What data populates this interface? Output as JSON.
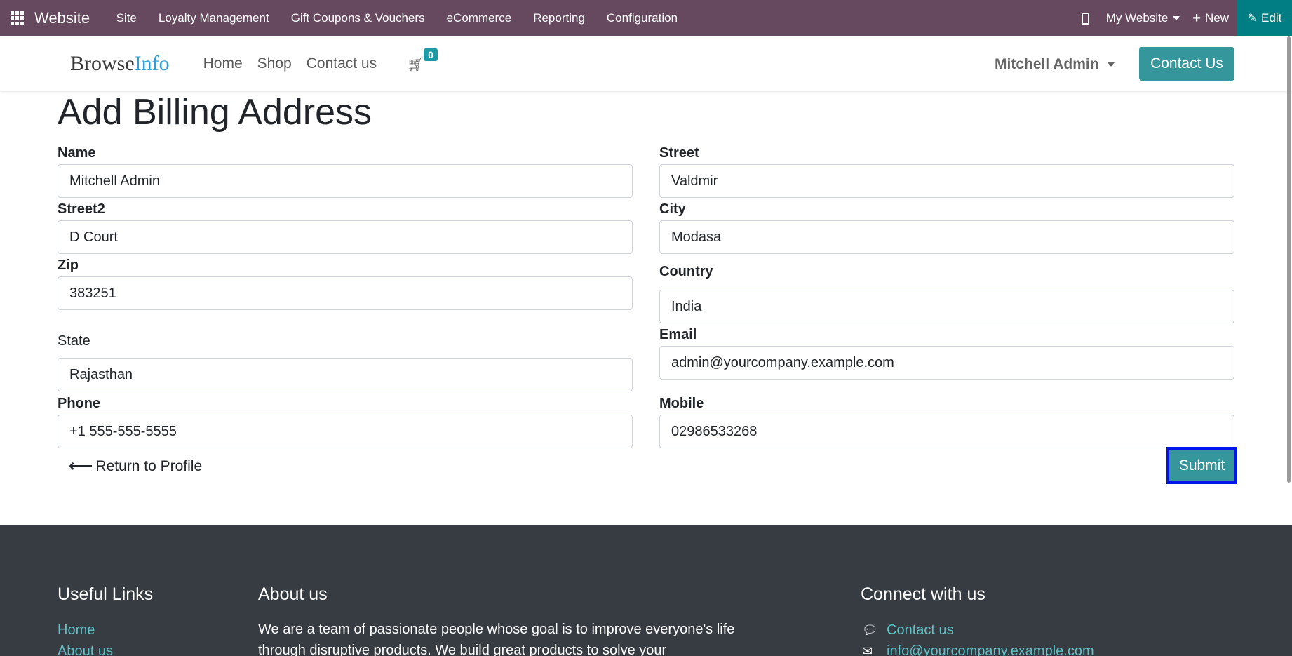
{
  "topbar": {
    "app_name": "Website",
    "menu": [
      "Site",
      "Loyalty Management",
      "Gift Coupons & Vouchers",
      "eCommerce",
      "Reporting",
      "Configuration"
    ],
    "website_selector": "My Website",
    "new_label": "New",
    "edit_label": "Edit",
    "bg_color": "#66495f",
    "edit_color": "#017e84"
  },
  "header": {
    "logo_part1": "Browse",
    "logo_part2": "Info",
    "nav": [
      "Home",
      "Shop",
      "Contact us"
    ],
    "cart_count": "0",
    "user": "Mitchell Admin",
    "cta": "Contact Us",
    "accent_color": "#35979c"
  },
  "form": {
    "title": "Add Billing Address",
    "fields": {
      "name": {
        "label": "Name",
        "value": "Mitchell Admin"
      },
      "street": {
        "label": "Street",
        "value": "Valdmir"
      },
      "street2": {
        "label": "Street2",
        "value": "D Court"
      },
      "city": {
        "label": "City",
        "value": "Modasa"
      },
      "zip": {
        "label": "Zip",
        "value": "383251"
      },
      "country": {
        "label": "Country",
        "value": "India"
      },
      "state": {
        "label": "State",
        "value": "Rajasthan"
      },
      "email": {
        "label": "Email",
        "value": "admin@yourcompany.example.com"
      },
      "phone": {
        "label": "Phone",
        "value": "+1 555-555-5555"
      },
      "mobile": {
        "label": "Mobile",
        "value": "02986533268"
      }
    },
    "return_label": "Return to Profile",
    "submit_label": "Submit"
  },
  "footer": {
    "useful_links_title": "Useful Links",
    "useful_links": [
      "Home",
      "About us"
    ],
    "about_title": "About us",
    "about_text": "We are a team of passionate people whose goal is to improve everyone's life through disruptive products. We build great products to solve your",
    "connect_title": "Connect with us",
    "connect_links": [
      "Contact us",
      "info@yourcompany.example.com"
    ]
  }
}
